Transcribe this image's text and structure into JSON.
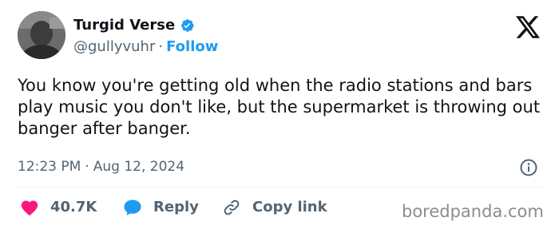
{
  "author": {
    "display_name": "Turgid Verse",
    "handle": "@gullyvuhr",
    "separator": "·",
    "follow_label": "Follow"
  },
  "tweet": {
    "text": "You know you're getting old when the radio stations and bars play music you don't like, but the supermarket is throwing out banger after banger.",
    "time": "12:23 PM",
    "separator": "·",
    "date": "Aug 12, 2024"
  },
  "actions": {
    "like_count": "40.7K",
    "reply_label": "Reply",
    "copy_link_label": "Copy link"
  },
  "watermark": "boredpanda.com",
  "icons": {
    "verified": "verified-badge-icon",
    "logo": "x-logo-icon",
    "info": "info-icon",
    "like": "heart-icon",
    "reply": "speech-bubble-icon",
    "copy_link": "link-icon"
  },
  "colors": {
    "accent": "#1d9bf0",
    "like": "#f91880",
    "text": "#0f1419",
    "secondary_text": "#536471",
    "watermark": "#8c8c8c"
  }
}
